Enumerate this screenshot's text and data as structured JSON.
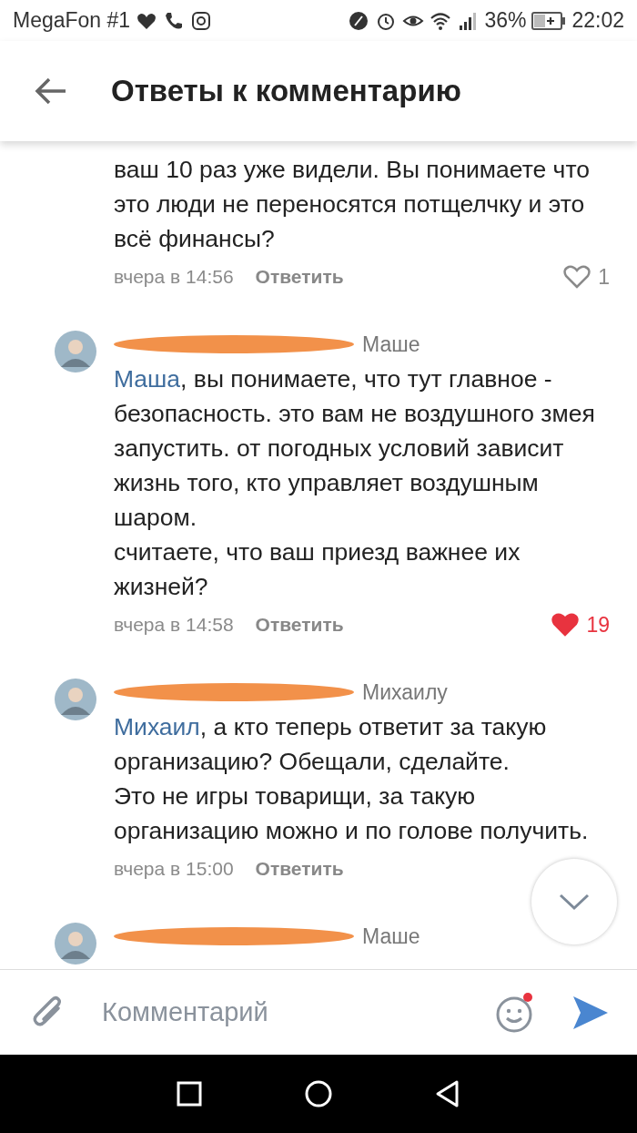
{
  "status_bar": {
    "carrier": "MegaFon #1",
    "battery": "36%",
    "time": "22:02"
  },
  "header": {
    "title": "Ответы к комментарию"
  },
  "comments": [
    {
      "text": "ваш 10 раз уже видели. Вы понимаете что это люди не переносятся потщелчку и это всё финансы?",
      "time": "вчера в 14:56",
      "reply": "Ответить",
      "likes": "1",
      "liked": false
    },
    {
      "recipient": "Маше",
      "mention": "Маша",
      "text": ", вы понимаете, что тут главное - безопасность. это вам не воздушного змея запустить. от погодных условий зависит жизнь того, кто управляет воздушным шаром.\nсчитаете, что ваш приезд важнее их жизней?",
      "time": "вчера в 14:58",
      "reply": "Ответить",
      "likes": "19",
      "liked": true
    },
    {
      "recipient": "Михаилу",
      "mention": "Михаил",
      "text": ", а кто теперь ответит за такую организацию? Обещали, сделайте.\nЭто не игры товарищи, за такую организацию можно и по голове получить.",
      "time": "вчера в 15:00",
      "reply": "Ответить"
    },
    {
      "recipient": "Маше"
    }
  ],
  "composer": {
    "placeholder": "Комментарий",
    "emoji_notification": true
  }
}
